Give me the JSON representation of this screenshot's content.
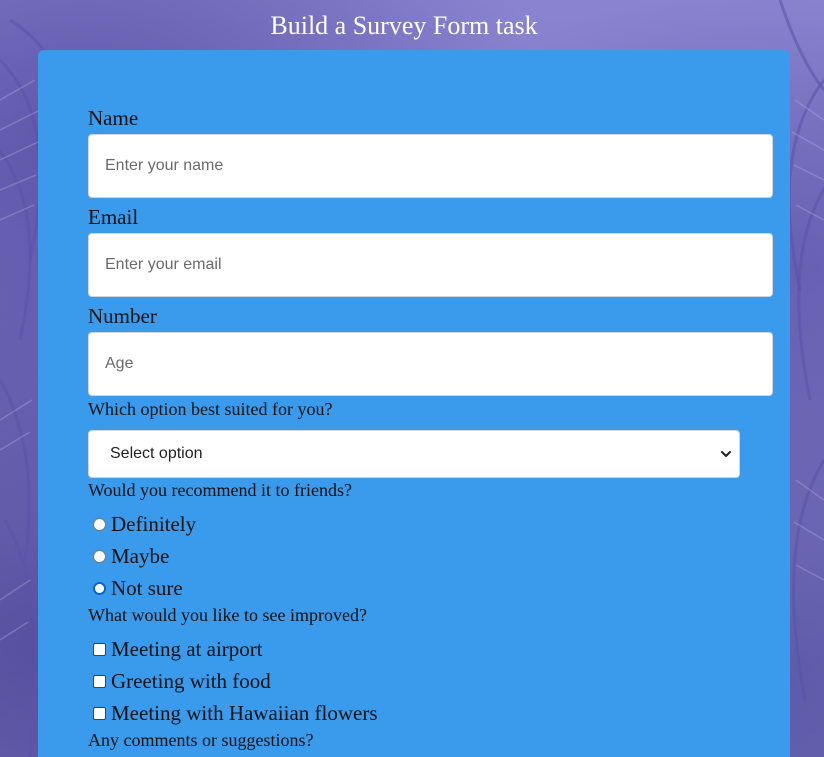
{
  "page": {
    "title": "Build a Survey Form task"
  },
  "form": {
    "name": {
      "label": "Name",
      "placeholder": "Enter your name",
      "value": ""
    },
    "email": {
      "label": "Email",
      "placeholder": "Enter your email",
      "value": ""
    },
    "number": {
      "label": "Number",
      "placeholder": "Age",
      "value": ""
    },
    "best_option": {
      "label": "Which option best suited for you?",
      "selected": "Select option"
    },
    "recommend": {
      "label": "Would you recommend it to friends?",
      "options": [
        {
          "label": "Definitely",
          "checked": false
        },
        {
          "label": "Maybe",
          "checked": false
        },
        {
          "label": "Not sure",
          "checked": true
        }
      ]
    },
    "improve": {
      "label": "What would you like to see improved?",
      "options": [
        {
          "label": "Meeting at airport",
          "checked": false
        },
        {
          "label": "Greeting with food",
          "checked": false
        },
        {
          "label": "Meeting with Hawaiian flowers",
          "checked": false
        }
      ]
    },
    "comments": {
      "label": "Any comments or suggestions?"
    }
  },
  "colors": {
    "background": "#8078c6",
    "card": "#3a9bec",
    "radio_selected": "#0b63ce"
  },
  "icons": {
    "select_arrow": "chevron-down-icon"
  }
}
